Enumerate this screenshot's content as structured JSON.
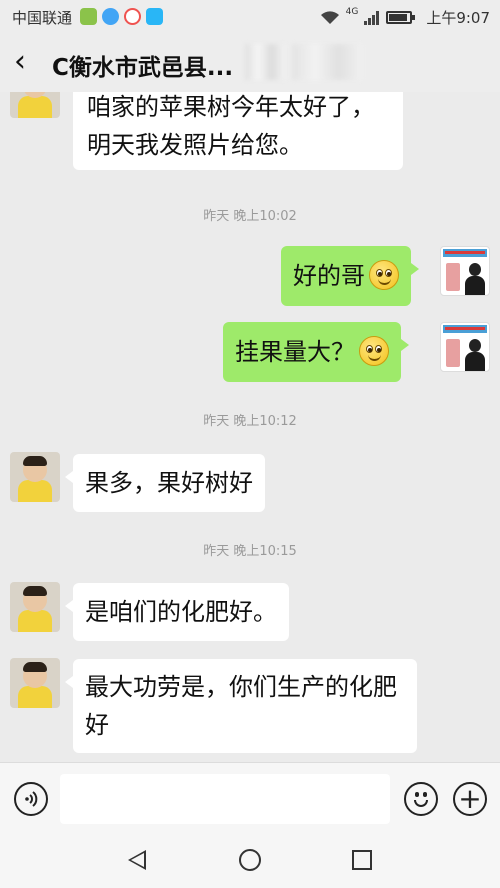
{
  "status_bar": {
    "carrier": "中国联通",
    "time": "上午9:07",
    "network": "4G",
    "app_icon_colors": [
      "#8bc34a",
      "#42a5f5",
      "#ef5350",
      "#29b6f6"
    ]
  },
  "header": {
    "back_icon": "chevron-left-icon",
    "title": "C衡水市武邑县..."
  },
  "messages": [
    {
      "id": "m1",
      "side": "left",
      "avatar": "child-avatar",
      "text": "咱家的苹果树今年太好了，明天我发照片给您。"
    },
    {
      "id": "t1",
      "type": "time",
      "text": "昨天 晚上10:02"
    },
    {
      "id": "m2",
      "side": "right",
      "avatar": "business-avatar",
      "text": "好的哥",
      "emoji": "smiley-icon"
    },
    {
      "id": "m3",
      "side": "right",
      "avatar": "business-avatar",
      "text": "挂果量大？",
      "emoji": "smiley-icon"
    },
    {
      "id": "t2",
      "type": "time",
      "text": "昨天 晚上10:12"
    },
    {
      "id": "m4",
      "side": "left",
      "avatar": "child-avatar",
      "text": "果多，果好树好"
    },
    {
      "id": "t3",
      "type": "time",
      "text": "昨天 晚上10:15"
    },
    {
      "id": "m5",
      "side": "left",
      "avatar": "child-avatar",
      "text": "是咱们的化肥好。"
    },
    {
      "id": "m6",
      "side": "left",
      "avatar": "child-avatar",
      "text": "最大功劳是，你们生产的化肥好"
    }
  ],
  "input_bar": {
    "voice_icon": "voice-icon",
    "emoji_icon": "emoji-icon",
    "plus_icon": "plus-icon",
    "input_value": ""
  },
  "nav_bar": {
    "back_icon": "nav-back-icon",
    "home_icon": "nav-home-icon",
    "recent_icon": "nav-recent-icon"
  },
  "colors": {
    "right_bubble": "#9eea6a",
    "left_bubble": "#ffffff",
    "chat_background": "#ebebeb"
  }
}
